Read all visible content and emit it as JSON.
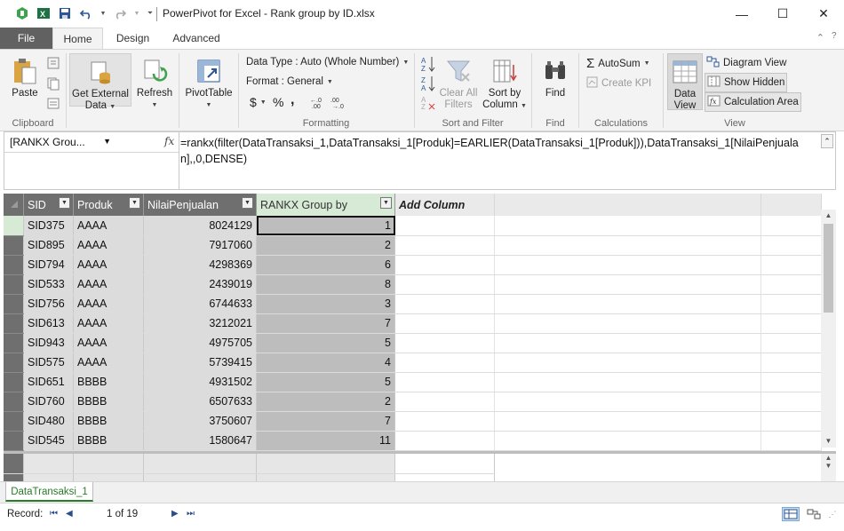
{
  "window": {
    "title": "PowerPivot for Excel - Rank group by ID.xlsx",
    "minimize": "—",
    "maximize": "☐",
    "close": "✕"
  },
  "tabs": {
    "file": "File",
    "home": "Home",
    "design": "Design",
    "advanced": "Advanced"
  },
  "ribbon": {
    "clipboard": {
      "label": "Clipboard",
      "paste": "Paste"
    },
    "get_external": {
      "line1": "Get External",
      "line2": "Data"
    },
    "refresh": "Refresh",
    "pivottable": "PivotTable",
    "formatting": {
      "label": "Formatting",
      "data_type": "Data Type : Auto (Whole Number)",
      "format": "Format : General",
      "currency": "$",
      "percent": "%",
      "comma": ","
    },
    "sort_filter": {
      "label": "Sort and Filter",
      "clear_line1": "Clear All",
      "clear_line2": "Filters",
      "sort_line1": "Sort by",
      "sort_line2": "Column"
    },
    "find": {
      "label": "Find",
      "button": "Find"
    },
    "calculations": {
      "label": "Calculations",
      "autosum": "AutoSum",
      "create_kpi": "Create KPI"
    },
    "view": {
      "label": "View",
      "data_view_line1": "Data",
      "data_view_line2": "View",
      "diagram_view": "Diagram View",
      "show_hidden": "Show Hidden",
      "calculation_area": "Calculation Area"
    }
  },
  "formula_bar": {
    "name_box": "[RANKX Grou...",
    "fx": "fx",
    "formula": "=rankx(filter(DataTransaksi_1,DataTransaksi_1[Produk]=EARLIER(DataTransaksi_1[Produk])),DataTransaksi_1[NilaiPenjualan],,0,DENSE)"
  },
  "table": {
    "columns": [
      "SID",
      "Produk",
      "NilaiPenjualan",
      "RANKX Group by",
      "Add Column"
    ],
    "rows": [
      {
        "sid": "SID375",
        "produk": "AAAA",
        "nilai": "8024129",
        "rank": "1"
      },
      {
        "sid": "SID895",
        "produk": "AAAA",
        "nilai": "7917060",
        "rank": "2"
      },
      {
        "sid": "SID794",
        "produk": "AAAA",
        "nilai": "4298369",
        "rank": "6"
      },
      {
        "sid": "SID533",
        "produk": "AAAA",
        "nilai": "2439019",
        "rank": "8"
      },
      {
        "sid": "SID756",
        "produk": "AAAA",
        "nilai": "6744633",
        "rank": "3"
      },
      {
        "sid": "SID613",
        "produk": "AAAA",
        "nilai": "3212021",
        "rank": "7"
      },
      {
        "sid": "SID943",
        "produk": "AAAA",
        "nilai": "4975705",
        "rank": "5"
      },
      {
        "sid": "SID575",
        "produk": "AAAA",
        "nilai": "5739415",
        "rank": "4"
      },
      {
        "sid": "SID651",
        "produk": "BBBB",
        "nilai": "4931502",
        "rank": "5"
      },
      {
        "sid": "SID760",
        "produk": "BBBB",
        "nilai": "6507633",
        "rank": "2"
      },
      {
        "sid": "SID480",
        "produk": "BBBB",
        "nilai": "3750607",
        "rank": "7"
      },
      {
        "sid": "SID545",
        "produk": "BBBB",
        "nilai": "1580647",
        "rank": "11"
      }
    ]
  },
  "sheet_tab": "DataTransaksi_1",
  "status": {
    "record_label": "Record:",
    "record_count": "1 of 19"
  }
}
